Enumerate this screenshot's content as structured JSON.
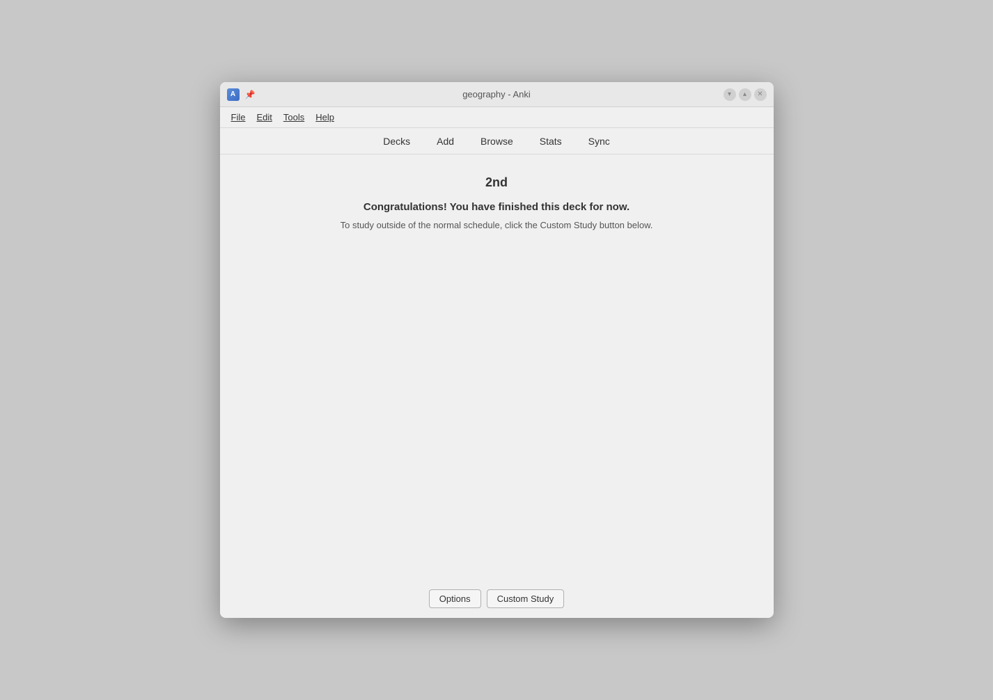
{
  "window": {
    "title": "geography - Anki"
  },
  "titlebar": {
    "title": "geography - Anki",
    "minimize_label": "−",
    "maximize_label": "▲",
    "close_label": "×"
  },
  "menubar": {
    "items": [
      {
        "label": "File",
        "underline": "F",
        "rest": "ile"
      },
      {
        "label": "Edit",
        "underline": "E",
        "rest": "dit"
      },
      {
        "label": "Tools",
        "underline": "T",
        "rest": "ools"
      },
      {
        "label": "Help",
        "underline": "H",
        "rest": "elp"
      }
    ]
  },
  "navbar": {
    "items": [
      {
        "id": "decks",
        "label": "Decks"
      },
      {
        "id": "add",
        "label": "Add"
      },
      {
        "id": "browse",
        "label": "Browse"
      },
      {
        "id": "stats",
        "label": "Stats"
      },
      {
        "id": "sync",
        "label": "Sync"
      }
    ]
  },
  "content": {
    "deck_title": "2nd",
    "congratulations": "Congratulations! You have finished this deck for now.",
    "instruction": "To study outside of the normal schedule, click the Custom Study button below."
  },
  "footer": {
    "options_label": "Options",
    "custom_study_label": "Custom Study"
  }
}
